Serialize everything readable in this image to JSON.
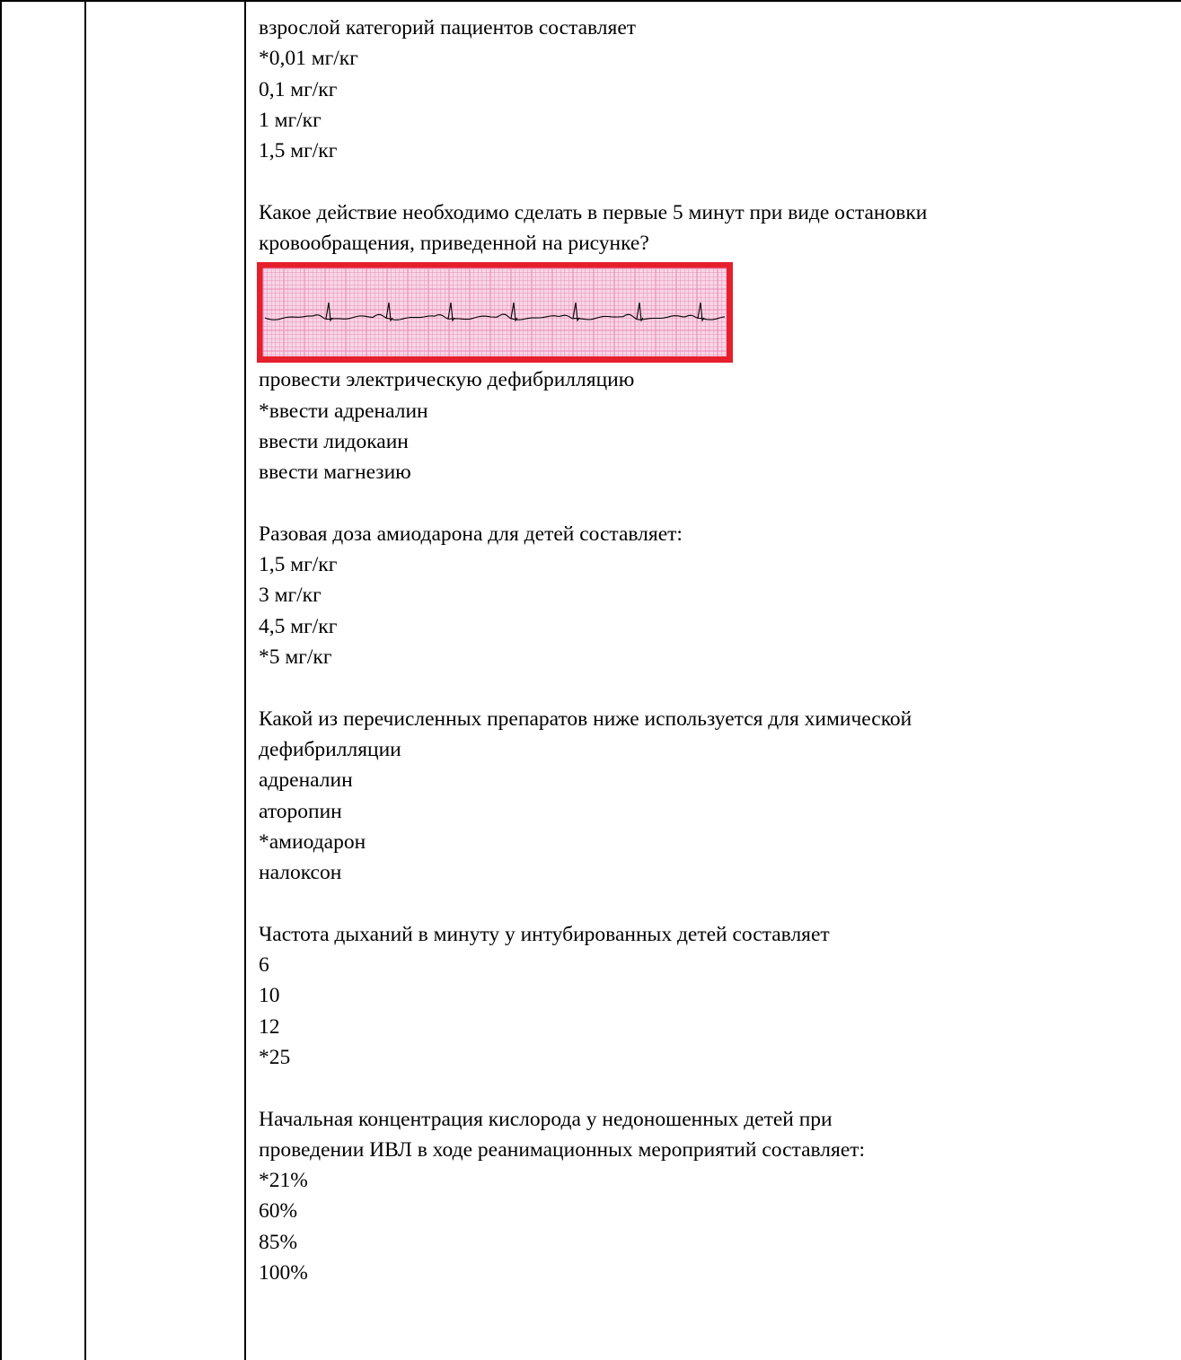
{
  "questions": [
    {
      "text_lines": [
        "взрослой категорий пациентов составляет"
      ],
      "options": [
        "*0,01 мг/кг",
        "0,1 мг/кг",
        "1 мг/кг",
        "1,5 мг/кг"
      ]
    },
    {
      "text_lines": [
        "Какое действие необходимо сделать в первые 5 минут при виде остановки",
        "кровообращения, приведенной на рисунке?"
      ],
      "figure": {
        "frame_color": "#e5202c",
        "grid_color": "#e98ab4",
        "paper_color": "#f8d6e6",
        "trace_color": "#000000"
      },
      "options": [
        "провести электрическую дефибрилляцию",
        "*ввести адреналин",
        "ввести лидокаин",
        "ввести магнезию"
      ]
    },
    {
      "text_lines": [
        "Разовая доза амиодарона для детей составляет:"
      ],
      "options": [
        "1,5 мг/кг",
        "3 мг/кг",
        "4,5 мг/кг",
        "*5 мг/кг"
      ]
    },
    {
      "text_lines": [
        "Какой из перечисленных препаратов ниже используется для химической",
        "дефибрилляции"
      ],
      "options": [
        "адреналин",
        "аторопин",
        "*амиодарон",
        "налоксон"
      ]
    },
    {
      "text_lines": [
        "Частота дыханий в минуту у интубированных детей составляет"
      ],
      "options": [
        "6",
        "10",
        "12",
        "*25"
      ]
    },
    {
      "text_lines": [
        "Начальная концентрация кислорода у недоношенных детей при",
        "проведении ИВЛ в ходе реанимационных мероприятий составляет:"
      ],
      "options": [
        "*21%",
        "60%",
        "85%",
        "100%"
      ]
    }
  ]
}
